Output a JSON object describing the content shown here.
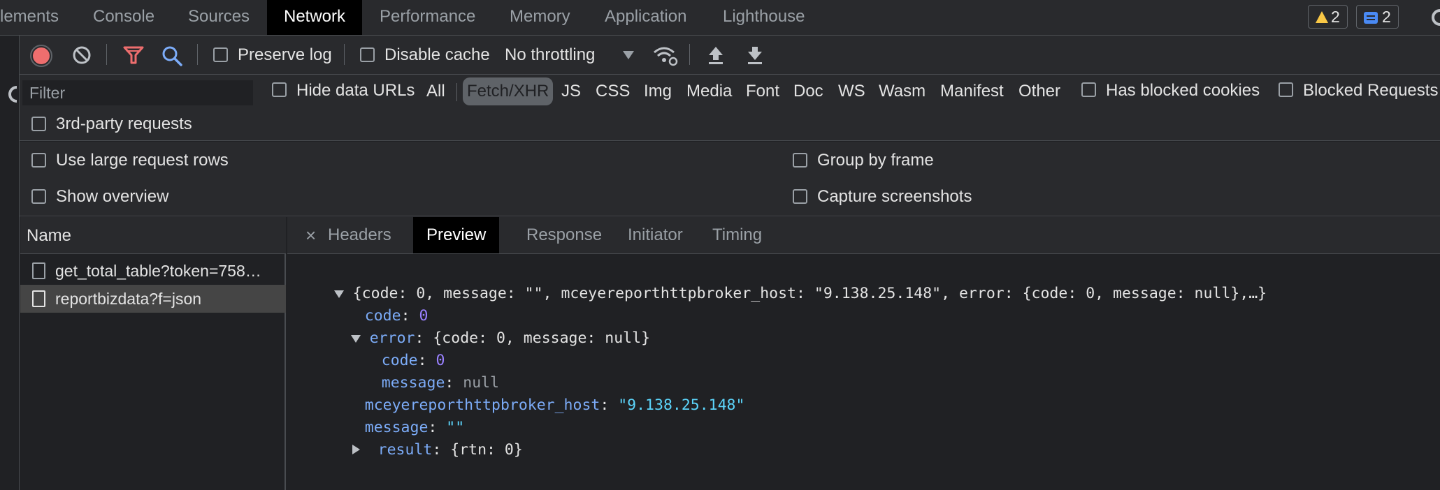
{
  "tabbar": {
    "tabs": [
      {
        "label": "lements"
      },
      {
        "label": "Console"
      },
      {
        "label": "Sources"
      },
      {
        "label": "Network"
      },
      {
        "label": "Performance"
      },
      {
        "label": "Memory"
      },
      {
        "label": "Application"
      },
      {
        "label": "Lighthouse"
      }
    ],
    "active_tab": "Network",
    "warnings_count": "2",
    "messages_count": "2"
  },
  "toolbar": {
    "preserve_log": "Preserve log",
    "disable_cache": "Disable cache",
    "throttling": "No throttling"
  },
  "filter": {
    "placeholder": "Filter",
    "hide_data_urls": "Hide data URLs",
    "types": [
      "All",
      "Fetch/XHR",
      "JS",
      "CSS",
      "Img",
      "Media",
      "Font",
      "Doc",
      "WS",
      "Wasm",
      "Manifest",
      "Other"
    ],
    "active_type": "Fetch/XHR",
    "has_blocked_cookies": "Has blocked cookies",
    "blocked_requests": "Blocked Requests",
    "third_party": "3rd-party requests"
  },
  "settings": {
    "large_rows": "Use large request rows",
    "show_overview": "Show overview",
    "group_by_frame": "Group by frame",
    "capture_screenshots": "Capture screenshots"
  },
  "requests": {
    "header": "Name",
    "items": [
      {
        "name": "get_total_table?token=758…",
        "selected": false
      },
      {
        "name": "reportbizdata?f=json",
        "selected": true
      }
    ]
  },
  "detail": {
    "close": "×",
    "tabs": [
      "Headers",
      "Preview",
      "Response",
      "Initiator",
      "Timing"
    ],
    "active_tab": "Preview",
    "preview": {
      "summary": "{code: 0, message: \"\", mceyereporthttpbroker_host: \"9.138.25.148\", error: {code: 0, message: null},…}",
      "code_key": "code",
      "code_val": "0",
      "error_key": "error",
      "error_summary": "{code: 0, message: null}",
      "error_code_key": "code",
      "error_code_val": "0",
      "error_message_key": "message",
      "error_message_val": "null",
      "host_key": "mceyereporthttpbroker_host",
      "host_val": "\"9.138.25.148\"",
      "message_key": "message",
      "message_val": "\"\"",
      "result_key": "result",
      "result_summary": "{rtn: 0}"
    }
  },
  "colors": {
    "record": "#ee6e6e",
    "filter_funnel": "#ee6e6e",
    "search": "#7cacf8",
    "warning": "#f9c846",
    "message": "#4a8af4"
  }
}
